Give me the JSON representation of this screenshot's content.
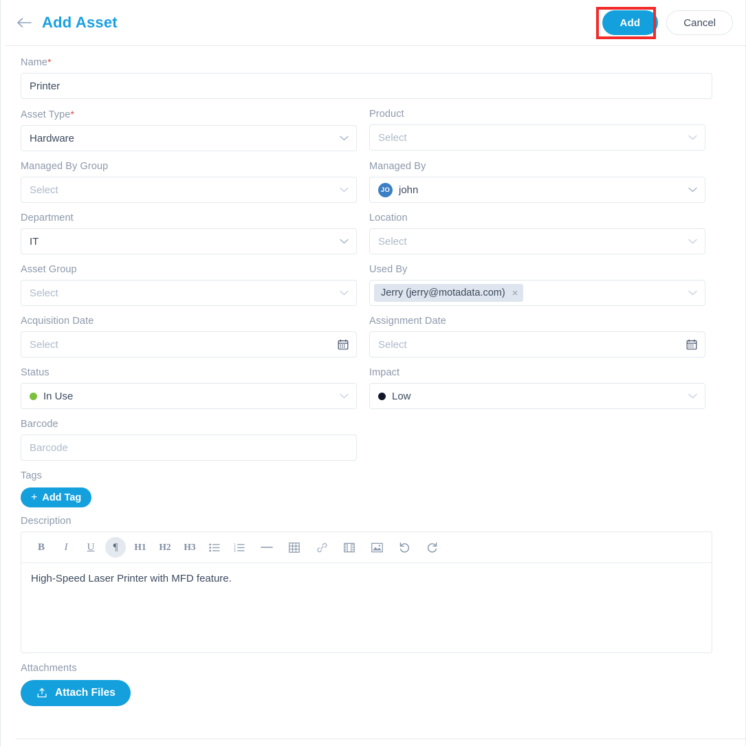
{
  "header": {
    "back_icon": "arrow-left-icon",
    "title": "Add Asset",
    "add_label": "Add",
    "cancel_label": "Cancel",
    "highlight_color": "#f22a2a",
    "accent_color": "#13a0dc"
  },
  "fields": {
    "name": {
      "label": "Name",
      "required": true,
      "value": "Printer"
    },
    "asset_type": {
      "label": "Asset Type",
      "required": true,
      "value": "Hardware"
    },
    "product": {
      "label": "Product",
      "placeholder": "Select"
    },
    "managed_by_group": {
      "label": "Managed By Group",
      "placeholder": "Select"
    },
    "managed_by": {
      "label": "Managed By",
      "value": "john",
      "avatar_initials": "JO",
      "avatar_color": "#3c7fc4"
    },
    "department": {
      "label": "Department",
      "value": "IT"
    },
    "location": {
      "label": "Location",
      "placeholder": "Select"
    },
    "asset_group": {
      "label": "Asset Group",
      "placeholder": "Select"
    },
    "used_by": {
      "label": "Used By",
      "chip": "Jerry (jerry@motadata.com)",
      "chip_remove": "×"
    },
    "acquisition_date": {
      "label": "Acquisition Date",
      "placeholder": "Select"
    },
    "assignment_date": {
      "label": "Assignment Date",
      "placeholder": "Select"
    },
    "status": {
      "label": "Status",
      "value": "In Use",
      "dot_color": "#7dbf3f"
    },
    "impact": {
      "label": "Impact",
      "value": "Low",
      "dot_color": "#10182b"
    },
    "barcode": {
      "label": "Barcode",
      "placeholder": "Barcode"
    },
    "tags": {
      "label": "Tags",
      "add_label": "Add Tag",
      "add_icon": "plus-icon"
    },
    "description": {
      "label": "Description",
      "value": "High-Speed Laser Printer with MFD feature."
    },
    "attachments": {
      "label": "Attachments",
      "button_label": "Attach Files",
      "button_icon": "upload-icon"
    }
  },
  "editor_toolbar": [
    {
      "name": "bold-icon",
      "glyph": "B",
      "style": "txt",
      "active": false
    },
    {
      "name": "italic-icon",
      "glyph": "I",
      "style": "txt",
      "active": false
    },
    {
      "name": "underline-icon",
      "glyph": "U",
      "style": "txt",
      "active": false
    },
    {
      "name": "paragraph-icon",
      "glyph": "¶",
      "style": "txt",
      "active": true
    },
    {
      "name": "heading-1-icon",
      "glyph": "H1",
      "style": "h",
      "active": false
    },
    {
      "name": "heading-2-icon",
      "glyph": "H2",
      "style": "h",
      "active": false
    },
    {
      "name": "heading-3-icon",
      "glyph": "H3",
      "style": "h",
      "active": false
    },
    {
      "name": "bullet-list-icon",
      "glyph": "svg",
      "style": "svg",
      "active": false
    },
    {
      "name": "numbered-list-icon",
      "glyph": "svg",
      "style": "svg",
      "active": false
    },
    {
      "name": "horizontal-rule-icon",
      "glyph": "svg",
      "style": "svg",
      "active": false
    },
    {
      "name": "table-icon",
      "glyph": "svg",
      "style": "svg",
      "active": false
    },
    {
      "name": "link-icon",
      "glyph": "svg",
      "style": "svg",
      "active": false
    },
    {
      "name": "video-icon",
      "glyph": "svg",
      "style": "svg",
      "active": false
    },
    {
      "name": "image-icon",
      "glyph": "svg",
      "style": "svg",
      "active": false
    },
    {
      "name": "undo-icon",
      "glyph": "svg",
      "style": "svg",
      "active": false
    },
    {
      "name": "redo-icon",
      "glyph": "svg",
      "style": "svg",
      "active": false
    }
  ]
}
